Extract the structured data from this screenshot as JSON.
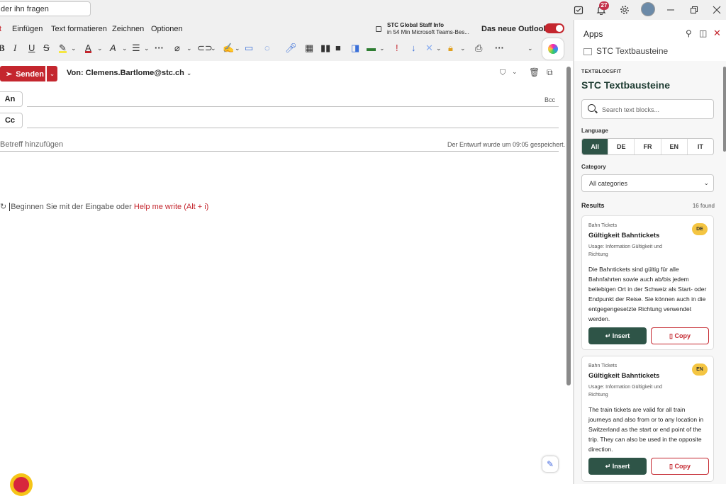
{
  "topbar": {
    "search_text": "der ihn fragen",
    "notifications_count": "27",
    "icons": [
      "todo-icon",
      "bell-icon",
      "gear-icon",
      "avatar",
      "minimize-icon",
      "restore-icon",
      "close-icon"
    ]
  },
  "menu": {
    "tabs": [
      "t",
      "Einfügen",
      "Text formatieren",
      "Zeichnen",
      "Optionen"
    ],
    "staff_info_title": "STC Global Staff Info",
    "staff_info_sub": "in 54 Min Microsoft Teams-Bes...",
    "new_outlook": "Das neue Outlook"
  },
  "compose": {
    "send_label": "Senden",
    "from": "Von: Clemens.Bartlome@stc.ch",
    "to_label": "An",
    "cc_label": "Cc",
    "bcc_label": "Bcc",
    "subject_placeholder": "Betreff hinzufügen",
    "draft_saved": "Der Entwurf wurde um 09:05 gespeichert.",
    "body_hint": "Beginnen Sie mit der Eingabe oder ",
    "body_hint_link": "Help me write (Alt + i)"
  },
  "apps_pane": {
    "title": "Apps",
    "addin_name": "STC Textbausteine"
  },
  "addin": {
    "brand_small": "TEXTBLOCSFIT",
    "brand": "STC Textbausteine",
    "search_placeholder": "Search text blocks...",
    "language_label": "Language",
    "languages": [
      "All",
      "DE",
      "FR",
      "EN",
      "IT"
    ],
    "category_label": "Category",
    "category_value": "All categories",
    "results_label": "Results",
    "results_count": "16 found",
    "insert_label": "Insert",
    "copy_label": "Copy",
    "cards": [
      {
        "category": "Bahn Tickets",
        "title": "Gültigkeit Bahntickets",
        "usage": "Usage: Information Gültigkeit und Richtung",
        "lang": "DE",
        "body": "Die Bahntickets sind gültig für alle Bahnfahrten sowie auch ab/bis jedem beliebigen Ort in der Schweiz als Start- oder Endpunkt der Reise. Sie können auch in die entgegengesetzte Richtung verwendet werden."
      },
      {
        "category": "Bahn Tickets",
        "title": "Gültigkeit Bahntickets",
        "usage": "Usage: Information Gültigkeit und Richtung",
        "lang": "EN",
        "body": "The train tickets are valid for all train journeys and also from or to any location in Switzerland as the start or end point of the trip. They can also be used in the opposite direction."
      }
    ]
  },
  "colors": {
    "accent_red": "#c4262e",
    "brand_green": "#2e5447",
    "badge_yellow": "#f4c542"
  }
}
